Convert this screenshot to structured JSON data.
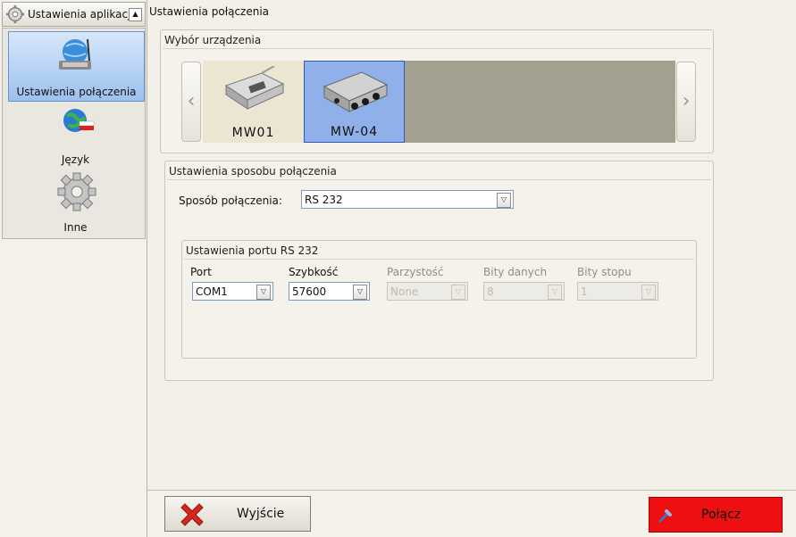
{
  "sidebar": {
    "header_title": "Ustawienia aplikacji",
    "collapse_glyph": "▲",
    "items": [
      {
        "label": "Ustawienia połączenia",
        "icon": "network-settings-icon",
        "selected": true
      },
      {
        "label": "Język",
        "icon": "globe-flag-icon",
        "selected": false
      },
      {
        "label": "Inne",
        "icon": "gear-icon",
        "selected": false
      }
    ]
  },
  "main": {
    "title": "Ustawienia połączenia",
    "device_group": {
      "title": "Wybór urządzenia",
      "prev_glyph": "‹",
      "next_glyph": "›",
      "devices": [
        {
          "label": "MW01",
          "selected": false
        },
        {
          "label": "MW-04",
          "selected": true
        }
      ]
    },
    "connection_group": {
      "title": "Ustawienia sposobu połączenia",
      "method_label": "Sposób połączenia:",
      "method_value": "RS 232",
      "port_group": {
        "title": "Ustawienia portu RS 232",
        "fields": [
          {
            "label": "Port",
            "value": "COM1",
            "enabled": true
          },
          {
            "label": "Szybkość",
            "value": "57600",
            "enabled": true
          },
          {
            "label": "Parzystość",
            "value": "None",
            "enabled": false
          },
          {
            "label": "Bity danych",
            "value": "8",
            "enabled": false
          },
          {
            "label": "Bity stopu",
            "value": "1",
            "enabled": false
          }
        ]
      }
    }
  },
  "bottom": {
    "exit_label": "Wyjście",
    "connect_label": "Połącz"
  },
  "colors": {
    "selection": "#9cc1ee",
    "connect_button": "#ee1010",
    "exit_icon": "#d9261c"
  },
  "dropdown_glyph": "▽"
}
